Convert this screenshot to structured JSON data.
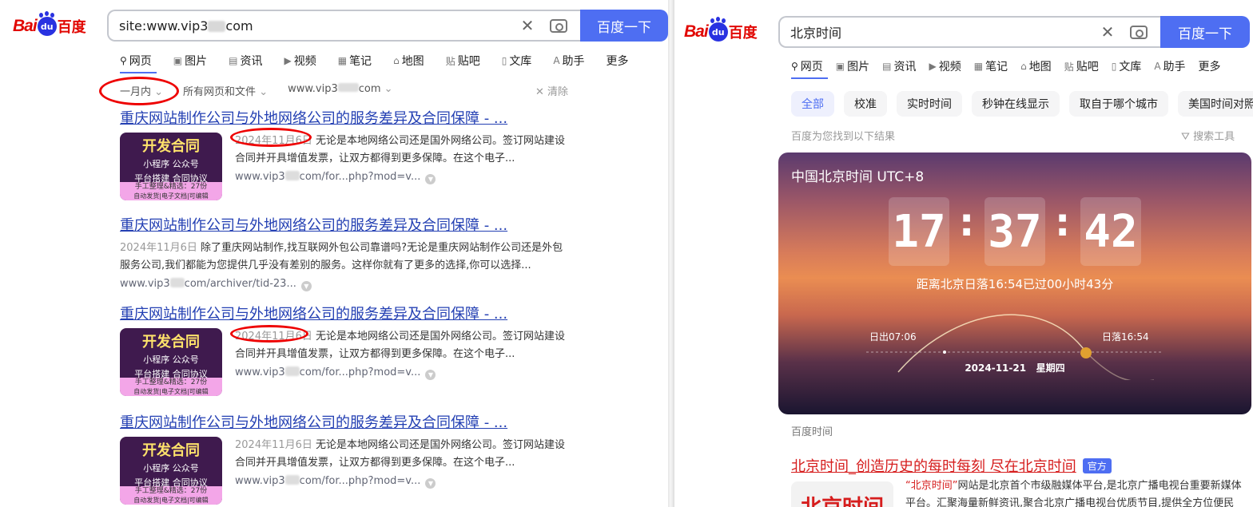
{
  "left": {
    "logo": {
      "bai": "Bai",
      "paw": "du",
      "cn": "百度"
    },
    "search": {
      "query_prefix": "site:www.vip3",
      "query_suffix": "com",
      "button": "百度一下"
    },
    "tabs": [
      {
        "icon": "search-icon",
        "glyph": "⚲",
        "label": "网页"
      },
      {
        "icon": "image-icon",
        "glyph": "▣",
        "label": "图片"
      },
      {
        "icon": "news-icon",
        "glyph": "▤",
        "label": "资讯"
      },
      {
        "icon": "video-icon",
        "glyph": "▶",
        "label": "视频"
      },
      {
        "icon": "note-icon",
        "glyph": "▦",
        "label": "笔记"
      },
      {
        "icon": "map-icon",
        "glyph": "⌂",
        "label": "地图"
      },
      {
        "icon": "tieba-icon",
        "glyph": "贴",
        "label": "贴吧"
      },
      {
        "icon": "wenku-icon",
        "glyph": "▯",
        "label": "文库"
      },
      {
        "icon": "ai-icon",
        "glyph": "A",
        "label": "助手"
      },
      {
        "icon": "",
        "glyph": "",
        "label": "更多"
      }
    ],
    "filters": {
      "time": "一月内",
      "type": "所有网页和文件",
      "site": "www.vip3",
      "site_suffix": "com",
      "clear": "清除"
    },
    "results": [
      {
        "title": "重庆网站制作公司与外地网络公司的服务差异及合同保障 - ...",
        "has_thumb": true,
        "date": "2024年11月6日",
        "snippet": "无论是本地网络公司还是国外网络公司。签订网站建设合同并开具增值发票，让双方都得到更多保障。在这个电子...",
        "url_prefix": "www.vip3",
        "url_suffix": "com/for...php?mod=v..."
      },
      {
        "title": "重庆网站制作公司与外地网络公司的服务差异及合同保障 - ...",
        "has_thumb": false,
        "date": "2024年11月6日",
        "snippet": "除了重庆网站制作,找互联网外包公司靠谱吗?无论是重庆网站制作公司还是外包服务公司,我们都能为您提供几乎没有差别的服务。这样你就有了更多的选择,你可以选择...",
        "url_prefix": "www.vip3",
        "url_suffix": "com/archiver/tid-23..."
      },
      {
        "title": "重庆网站制作公司与外地网络公司的服务差异及合同保障 - ...",
        "has_thumb": true,
        "date": "2024年11月6日",
        "snippet": "无论是本地网络公司还是国外网络公司。签订网站建设合同并开具增值发票，让双方都得到更多保障。在这个电子...",
        "url_prefix": "www.vip3",
        "url_suffix": "com/for...php?mod=v..."
      },
      {
        "title": "重庆网站制作公司与外地网络公司的服务差异及合同保障 - ...",
        "has_thumb": true,
        "date": "2024年11月6日",
        "snippet": "无论是本地网络公司还是国外网络公司。签订网站建设合同并开具增值发票，让双方都得到更多保障。在这个电子...",
        "url_prefix": "www.vip3",
        "url_suffix": "com/for...php?mod=v..."
      }
    ],
    "thumb": {
      "t1": "开发合同",
      "t2": "小程序  公众号",
      "t3": "平台搭建  合同协议",
      "t4": "手工整理&精选：27份",
      "t5": "自动发货|电子文档|可编辑"
    }
  },
  "right": {
    "logo": {
      "bai": "Bai",
      "paw": "du",
      "cn": "百度"
    },
    "search": {
      "query": "北京时间",
      "button": "百度一下"
    },
    "tabs": [
      {
        "icon": "search-icon",
        "glyph": "⚲",
        "label": "网页"
      },
      {
        "icon": "image-icon",
        "glyph": "▣",
        "label": "图片"
      },
      {
        "icon": "news-icon",
        "glyph": "▤",
        "label": "资讯"
      },
      {
        "icon": "video-icon",
        "glyph": "▶",
        "label": "视频"
      },
      {
        "icon": "note-icon",
        "glyph": "▦",
        "label": "笔记"
      },
      {
        "icon": "map-icon",
        "glyph": "⌂",
        "label": "地图"
      },
      {
        "icon": "tieba-icon",
        "glyph": "贴",
        "label": "贴吧"
      },
      {
        "icon": "wenku-icon",
        "glyph": "▯",
        "label": "文库"
      },
      {
        "icon": "ai-icon",
        "glyph": "A",
        "label": "助手"
      },
      {
        "icon": "",
        "glyph": "",
        "label": "更多"
      }
    ],
    "chips": [
      "全部",
      "校准",
      "实时时间",
      "秒钟在线显示",
      "取自于哪个城市",
      "美国时间对照表"
    ],
    "found": "百度为您找到以下结果",
    "tools": "搜索工具",
    "clock": {
      "header": "中国北京时间 UTC+8",
      "hours": "17",
      "minutes": "37",
      "seconds": "42",
      "sunset_info": "距离北京日落16:54已过00小时43分",
      "sunrise": "日出07:06",
      "sunset": "日落16:54",
      "date": "2024-11-21",
      "weekday": "星期四"
    },
    "source": "百度时间",
    "result": {
      "title": "北京时间_创造历史的每时每刻 尽在北京时间",
      "badge": "官方",
      "thumb_text": "北京时间",
      "snippet_hl": "“北京时间”",
      "snippet": "网站是北京首个市级融媒体平台,是北京广播电视台重要新媒体平台。汇聚海量新鲜资讯,聚合北京广播电视台优质节目,提供全方位便民"
    }
  },
  "colors": {
    "brand_blue": "#4e6ef2",
    "link_blue": "#2440b3",
    "baidu_red": "#e10601",
    "annotation_red": "#ee0000"
  }
}
